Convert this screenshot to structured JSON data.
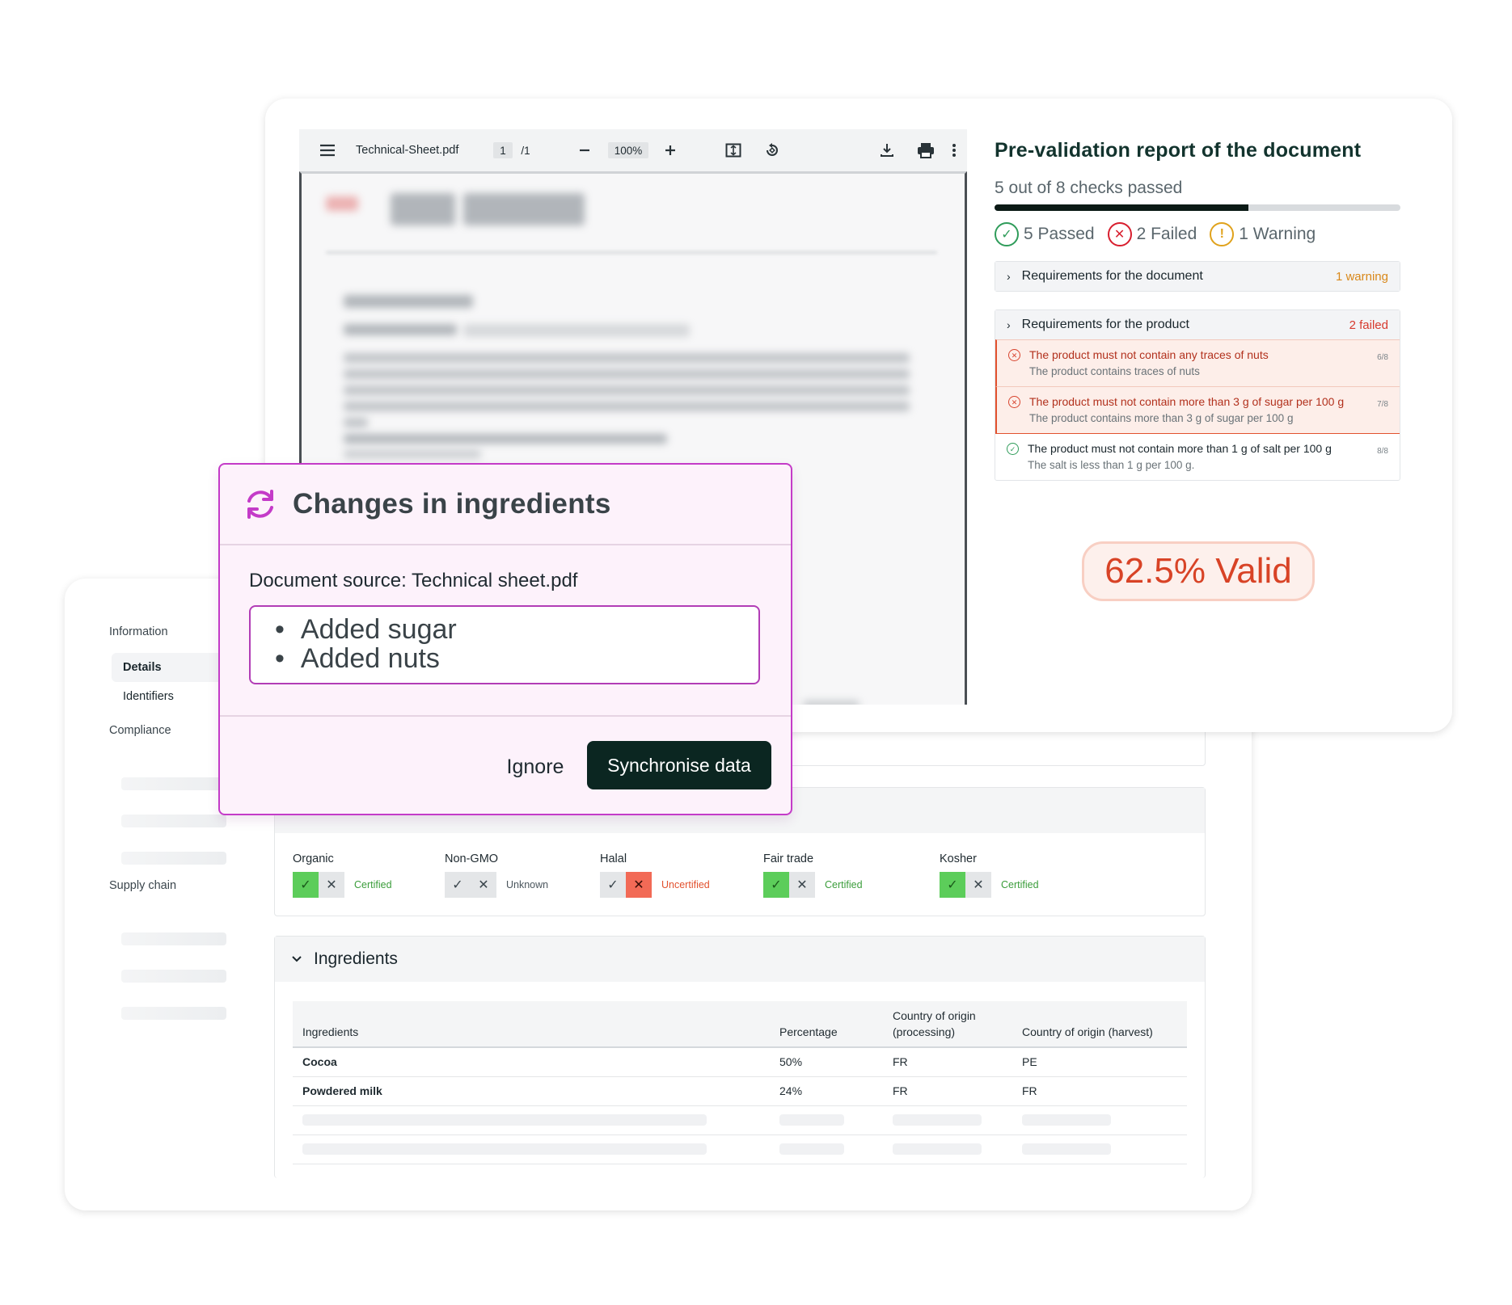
{
  "product_sheet": {
    "nav": {
      "information_heading": "Information",
      "items": [
        {
          "label": "Details"
        },
        {
          "label": "Identifiers"
        }
      ],
      "compliance_heading": "Compliance",
      "supply_chain_heading": "Supply chain"
    },
    "certifications": [
      {
        "label": "Organic",
        "state": "yes",
        "status": "Certified"
      },
      {
        "label": "Non-GMO",
        "state": "none",
        "status": "Unknown"
      },
      {
        "label": "Halal",
        "state": "no",
        "status": "Uncertified"
      },
      {
        "label": "Fair trade",
        "state": "yes",
        "status": "Certified"
      },
      {
        "label": "Kosher",
        "state": "yes",
        "status": "Certified"
      }
    ],
    "ingredients_section": {
      "title": "Ingredients",
      "columns": [
        "Ingredients",
        "Percentage",
        "Country of origin (processing)",
        "Country of origin (harvest)"
      ],
      "rows": [
        {
          "name": "Cocoa",
          "percentage": "50%",
          "processing": "FR",
          "harvest": "PE"
        },
        {
          "name": "Powdered milk",
          "percentage": "24%",
          "processing": "FR",
          "harvest": "FR"
        }
      ]
    }
  },
  "pdf_viewer": {
    "filename": "Technical-Sheet.pdf",
    "page_current": "1",
    "page_total": "/1",
    "zoom": "100%"
  },
  "report": {
    "title": "Pre-validation report of the document",
    "subtitle": "5 out of 8 checks passed",
    "progress_fraction": 0.625,
    "summary": {
      "passed": "5 Passed",
      "failed": "2 Failed",
      "warning": "1 Warning"
    },
    "document_requirements": {
      "label": "Requirements for the document",
      "badge": "1 warning"
    },
    "product_requirements": {
      "label": "Requirements for the product",
      "badge": "2 failed",
      "checks": [
        {
          "status": "fail",
          "title": "The product must not contain any traces of nuts",
          "detail": "The product contains traces of nuts",
          "count": "6/8"
        },
        {
          "status": "fail",
          "title": "The product must not contain more than 3 g of sugar per 100 g",
          "detail": "The product contains more than 3 g of sugar per 100 g",
          "count": "7/8"
        },
        {
          "status": "ok",
          "title": "The product must not contain more than 1 g of salt per 100 g",
          "detail": "The salt is less than 1 g per 100 g.",
          "count": "8/8"
        }
      ]
    },
    "valid_badge": "62.5% Valid"
  },
  "modal": {
    "title": "Changes in ingredients",
    "source": "Document source: Technical sheet.pdf",
    "changes": [
      "Added sugar",
      "Added nuts"
    ],
    "ignore_label": "Ignore",
    "sync_label": "Synchronise data"
  },
  "colors": {
    "accent_magenta": "#c43bc8",
    "primary_dark": "#0b2621",
    "fail_red": "#d84326",
    "pass_green": "#2f9c5a",
    "warn_orange": "#e0a21c"
  }
}
